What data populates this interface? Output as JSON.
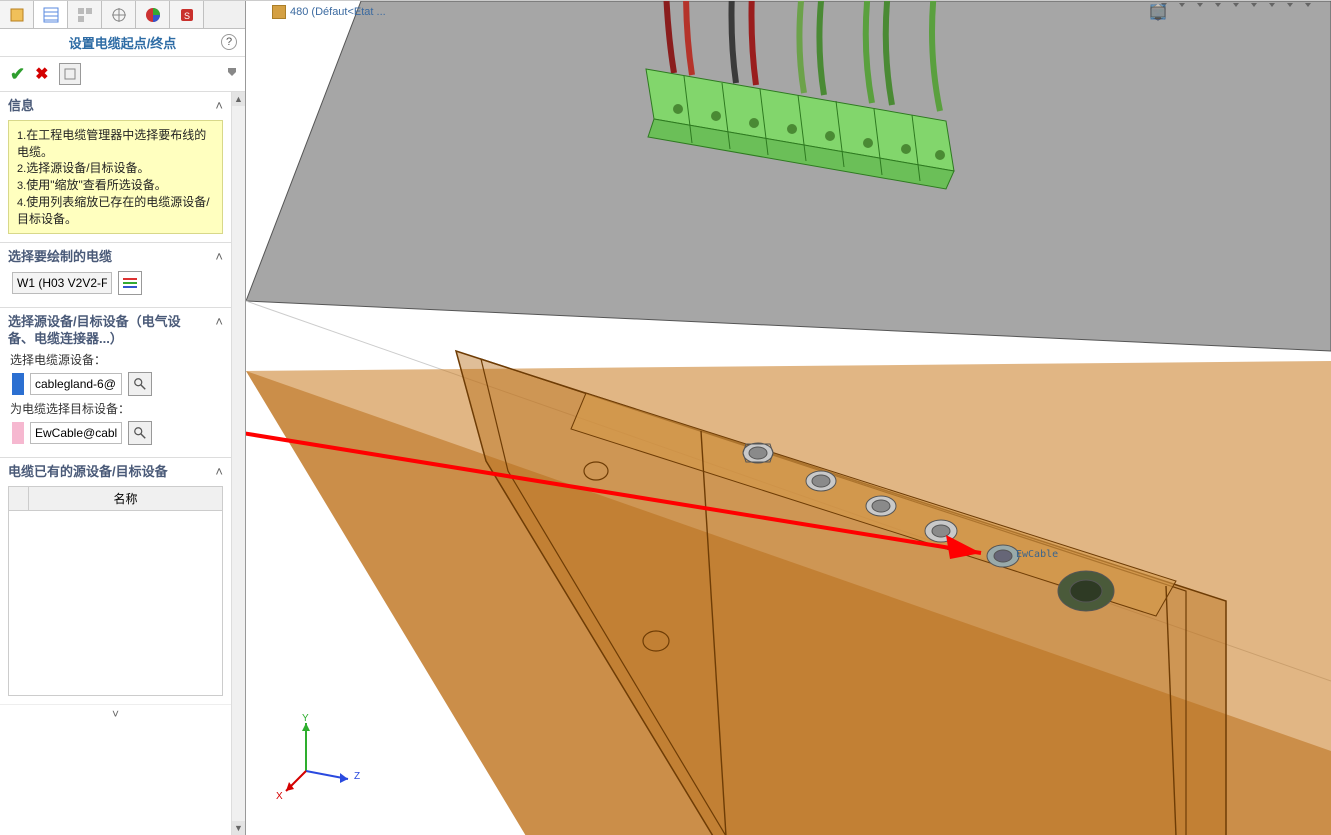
{
  "panel": {
    "title": "设置电缆起点/终点",
    "info_header": "信息",
    "info_lines": {
      "l1_idx": "1.",
      "l1": "在工程电缆管理器中选择要布线的电缆。",
      "l2_idx": "2.",
      "l2": "选择源设备/目标设备。",
      "l3_idx": "3.",
      "l3": "使用\"缩放\"查看所选设备。",
      "l4_idx": "4.",
      "l4": "使用列表缩放已存在的电缆源设备/目标设备。"
    },
    "section_cable": "选择要绘制的电缆",
    "cable_name": "W1 (H03 V2V2-F",
    "section_device": "选择源设备/目标设备（电气设备、电缆连接器...）",
    "src_label": "选择电缆源设备：",
    "src_value": "cablegland-6@",
    "dst_label": "为电缆选择目标设备：",
    "dst_value": "EwCable@cabl",
    "section_existing": "电缆已有的源设备/目标设备",
    "table_col": "名称"
  },
  "breadcrumb": {
    "text": "480  (Défaut<Etat ..."
  },
  "viewport": {
    "annotation": "EwCable",
    "axis_x": "X",
    "axis_y": "Y",
    "axis_z": "Z"
  }
}
